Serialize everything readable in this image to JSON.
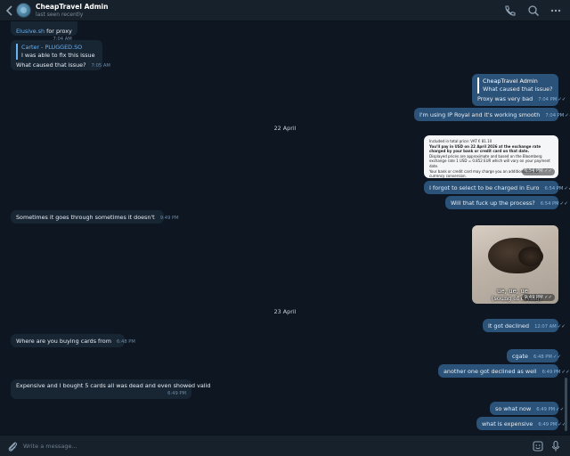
{
  "header": {
    "title": "CheapTravel Admin",
    "status": "last seen recently"
  },
  "messages": {
    "m1_link": "Elusive.sh",
    "m1_rest": "for proxy",
    "m1_time": "7:04 AM",
    "m2_qname": "Carter - PLUGGED.SO",
    "m2_qtext": "I was able to fix this issue",
    "m2_text": "What caused that issue?",
    "m2_time": "7:05 AM",
    "m3_qname": "CheapTravel Admin",
    "m3_qtext": "What caused that issue?",
    "m3_text": "Proxy was very bad",
    "m3_time": "7:04 PM",
    "m4_text": "I'm using IP Royal and it's working smooth",
    "m4_time": "7:04 PM",
    "date1": "22 April",
    "img1_line1": "Included in total price: VAT € 81.10",
    "img1_line2": "You'll pay in USD on 22 April 2026 at the exchange rate charged by your bank or credit card on that date.",
    "img1_line3": "Displayed prices are approximate and based on the Bloomberg exchange rate 1 USD = 0.852 EUR which will vary on your payment date.",
    "img1_line4": "Your bank or credit card may charge you an additional fee for currency conversion.",
    "img1_time": "6:54 PM",
    "m5_text": "I forgot to select to be charged in Euro",
    "m5_time": "6:54 PM",
    "m6_text": "Will that fuck up the process?",
    "m6_time": "6:54 PM",
    "m7_text": "Sometimes it goes through sometimes it doesn't",
    "m7_time": "9:49 PM",
    "img2_caption1": "ue, ue, ue",
    "img2_caption2": "(soung of crying)",
    "img2_time": "9:49 PM",
    "date2": "23 April",
    "m8_text": "It got declined",
    "m8_time": "12:07 AM",
    "m9_text": "Where are you buying cards from",
    "m9_time": "6:48 PM",
    "m10_text": "cgate",
    "m10_time": "6:48 PM",
    "m11_text": "another one got declined as well",
    "m11_time": "6:49 PM",
    "m12_text": "Expensive and I bought 5 cards all was dead and even showed valid",
    "m12_time": "6:49 PM",
    "m13_text": "so what now",
    "m13_time": "6:49 PM",
    "m14_text": "what is expensive",
    "m14_time": "6:49 PM"
  },
  "composer": {
    "placeholder": "Write a message..."
  },
  "colors": {
    "background": "#0e1621",
    "header": "#17212b",
    "incoming_bubble": "#182533",
    "outgoing_bubble": "#2b5278",
    "link": "#6ab3f3"
  },
  "icons": [
    "back-arrow-icon",
    "phone-icon",
    "search-icon",
    "more-icon",
    "attach-icon",
    "sticker-icon",
    "microphone-icon",
    "double-check-icon"
  ]
}
